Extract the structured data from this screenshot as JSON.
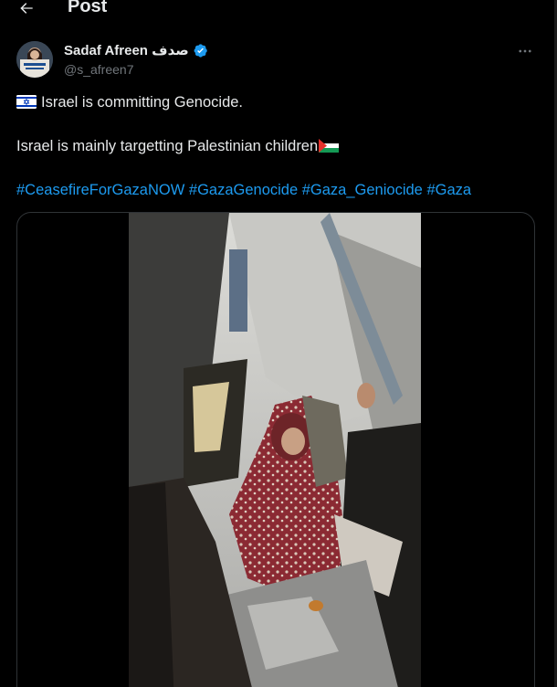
{
  "header": {
    "back_icon": "arrow-left-icon",
    "title": "Post"
  },
  "post": {
    "author": {
      "display_name": "Sadaf Afreen صدف",
      "handle": "@s_afreen7",
      "verified": true
    },
    "more_icon": "more-horizontal-icon",
    "line1": "Israel is committing Genocide.",
    "line1_flag": "israel-flag-emoji",
    "line2": "Israel is mainly targetting Palestinian children",
    "line2_flag": "palestine-flag-emoji",
    "hashtags": [
      "#CeasefireForGazaNOW",
      "#GazaGenocide",
      "#Gaza_Geniocide",
      "#Gaza"
    ],
    "media": {
      "type": "video"
    }
  },
  "colors": {
    "background": "#000000",
    "text": "#e7e9ea",
    "secondary": "#71767b",
    "link": "#1d9bf0",
    "border": "#2f3336"
  }
}
